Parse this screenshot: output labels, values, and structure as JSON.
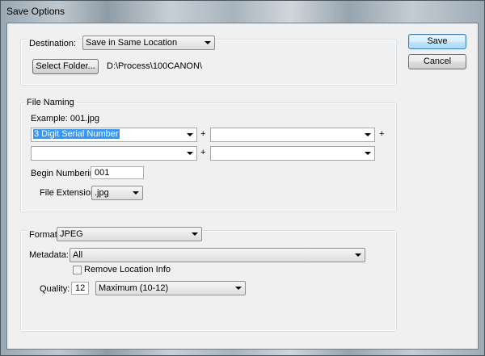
{
  "window": {
    "title": "Save Options"
  },
  "buttons": {
    "save": "Save",
    "cancel": "Cancel"
  },
  "destination": {
    "label": "Destination:",
    "value": "Save in Same Location",
    "select_folder": "Select Folder...",
    "path": "D:\\Process\\100CANON\\"
  },
  "file_naming": {
    "legend": "File Naming",
    "example": "Example:  001.jpg",
    "fields": [
      "3 Digit Serial Number",
      "",
      "",
      ""
    ],
    "plus": "+",
    "begin_numbering_label": "Begin Numbering:",
    "begin_numbering_value": "001",
    "file_extension_label": "File Extension:",
    "file_extension_value": ".jpg"
  },
  "format": {
    "label": "Format:",
    "value": "JPEG",
    "metadata_label": "Metadata:",
    "metadata_value": "All",
    "remove_location_label": "Remove Location Info",
    "quality_label": "Quality:",
    "quality_value": "12",
    "quality_preset": "Maximum  (10-12)"
  }
}
